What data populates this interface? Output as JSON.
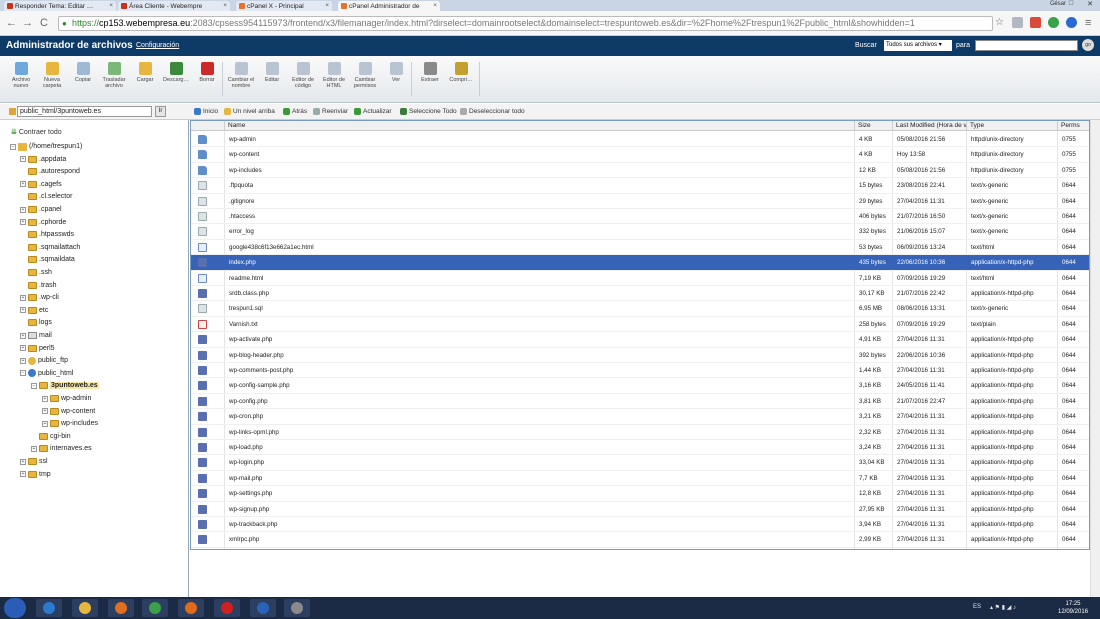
{
  "browser": {
    "tabs": [
      {
        "title": "Responder Tema: Editar …",
        "active": false,
        "favicon_color": "#c8331a"
      },
      {
        "title": "Área Cliente - Webempre",
        "active": false,
        "favicon_color": "#c8331a"
      },
      {
        "title": "cPanel X - Principal",
        "active": false,
        "favicon_color": "#e8722a"
      },
      {
        "title": "cPanel Administrador de",
        "active": true,
        "favicon_color": "#e8722a"
      }
    ],
    "tab_close": "×",
    "profile_name": "César",
    "url": {
      "scheme": "https://",
      "host": "cp153.webempresa.eu",
      "path": ":2083/cpsess954115973/frontend/x3/filemanager/index.html?dirselect=domainrootselect&domainselect=trespuntoweb.es&dir=%2Fhome%2Ftrespun1%2Fpublic_html&showhidden=1"
    },
    "nav": {
      "back": "←",
      "forward": "→",
      "reload": "C"
    }
  },
  "header": {
    "title": "Administrador de archivos",
    "config_link": "Configuración",
    "search_label": "Buscar",
    "search_scope": "Todos sus archivos ▾",
    "search_for": "para",
    "search_value": "",
    "go_label": "go"
  },
  "toolbar": [
    {
      "label": "Archivo nuevo",
      "icon": "new-file-icon",
      "color": "#6fa8dc"
    },
    {
      "label": "Nueva carpeta",
      "icon": "new-folder-icon",
      "color": "#e6b63e"
    },
    {
      "label": "Copiar",
      "icon": "copy-icon",
      "color": "#9fb8d6"
    },
    {
      "label": "Trasladar archivo",
      "icon": "move-icon",
      "color": "#7ab87a"
    },
    {
      "label": "Cargar",
      "icon": "upload-icon",
      "color": "#e6b63e"
    },
    {
      "label": "Descarg…",
      "icon": "download-icon",
      "color": "#3b8a3b"
    },
    {
      "label": "Borrar",
      "icon": "delete-icon",
      "color": "#cc2a2a"
    },
    {
      "label": "Cambiar el nombre",
      "icon": "rename-icon",
      "color": "#b9c4d2"
    },
    {
      "label": "Editar",
      "icon": "edit-icon",
      "color": "#b9c4d2"
    },
    {
      "label": "Editor de código",
      "icon": "code-editor-icon",
      "color": "#b9c4d2"
    },
    {
      "label": "Editor de HTML",
      "icon": "html-editor-icon",
      "color": "#b9c4d2"
    },
    {
      "label": "Cambiar permisos",
      "icon": "permissions-icon",
      "color": "#b9c4d2"
    },
    {
      "label": "Ver",
      "icon": "view-icon",
      "color": "#b9c4d2"
    },
    {
      "label": "Extraer",
      "icon": "extract-icon",
      "color": "#8a8a8a"
    },
    {
      "label": "Compri…",
      "icon": "compress-icon",
      "color": "#c4a030"
    }
  ],
  "path_input": "public_html/3puntoweb.es",
  "path_go": "Ir",
  "tree": {
    "collapse_all": "Contraer todo",
    "nodes": [
      {
        "label": "(/home/trespun1)",
        "depth": 0,
        "expander": "minus",
        "icon": "home"
      },
      {
        "label": ".appdata",
        "depth": 1,
        "expander": "plus",
        "icon": "folder"
      },
      {
        "label": ".autorespond",
        "depth": 1,
        "expander": "none",
        "icon": "folder"
      },
      {
        "label": ".cagefs",
        "depth": 1,
        "expander": "plus",
        "icon": "folder"
      },
      {
        "label": ".cl.selector",
        "depth": 1,
        "expander": "none",
        "icon": "folder"
      },
      {
        "label": ".cpanel",
        "depth": 1,
        "expander": "plus",
        "icon": "folder"
      },
      {
        "label": ".cphorde",
        "depth": 1,
        "expander": "plus",
        "icon": "folder"
      },
      {
        "label": ".htpasswds",
        "depth": 1,
        "expander": "none",
        "icon": "folder"
      },
      {
        "label": ".sqmailattach",
        "depth": 1,
        "expander": "none",
        "icon": "folder"
      },
      {
        "label": ".sqmaildata",
        "depth": 1,
        "expander": "none",
        "icon": "folder"
      },
      {
        "label": ".ssh",
        "depth": 1,
        "expander": "none",
        "icon": "folder"
      },
      {
        "label": ".trash",
        "depth": 1,
        "expander": "none",
        "icon": "folder"
      },
      {
        "label": ".wp-cli",
        "depth": 1,
        "expander": "plus",
        "icon": "folder"
      },
      {
        "label": "etc",
        "depth": 1,
        "expander": "plus",
        "icon": "folder"
      },
      {
        "label": "logs",
        "depth": 1,
        "expander": "none",
        "icon": "folder"
      },
      {
        "label": "mail",
        "depth": 1,
        "expander": "plus",
        "icon": "mail"
      },
      {
        "label": "perl5",
        "depth": 1,
        "expander": "plus",
        "icon": "folder"
      },
      {
        "label": "public_ftp",
        "depth": 1,
        "expander": "plus",
        "icon": "ftp"
      },
      {
        "label": "public_html",
        "depth": 1,
        "expander": "minus",
        "icon": "globe"
      },
      {
        "label": "3puntoweb.es",
        "depth": 2,
        "expander": "minus",
        "icon": "folder",
        "selected": true
      },
      {
        "label": "wp-admin",
        "depth": 3,
        "expander": "plus",
        "icon": "folder"
      },
      {
        "label": "wp-content",
        "depth": 3,
        "expander": "plus",
        "icon": "folder"
      },
      {
        "label": "wp-includes",
        "depth": 3,
        "expander": "plus",
        "icon": "folder"
      },
      {
        "label": "cgi-bin",
        "depth": 2,
        "expander": "none",
        "icon": "folder"
      },
      {
        "label": "internaves.es",
        "depth": 2,
        "expander": "plus",
        "icon": "folder"
      },
      {
        "label": "ssl",
        "depth": 1,
        "expander": "plus",
        "icon": "folder"
      },
      {
        "label": "tmp",
        "depth": 1,
        "expander": "plus",
        "icon": "folder"
      }
    ]
  },
  "actions": [
    {
      "label": "Inicio",
      "icon": "home-icon",
      "color": "#3a7ac8"
    },
    {
      "label": "Un nivel arriba",
      "icon": "up-level-icon",
      "color": "#e6b63e"
    },
    {
      "label": "Atrás",
      "icon": "back-arrow-icon",
      "color": "#3a9a3a"
    },
    {
      "label": "Reenviar",
      "icon": "forward-arrow-icon",
      "color": "#9aa"
    },
    {
      "label": "Actualizar",
      "icon": "refresh-icon",
      "color": "#3a9a3a"
    },
    {
      "label": "Seleccione Todo",
      "icon": "select-all-icon",
      "color": "#3a7a3a"
    },
    {
      "label": "Deseleccionar todo",
      "icon": "deselect-all-icon",
      "color": "#aaa"
    }
  ],
  "file_table": {
    "columns": [
      "Name",
      "Size",
      "Last Modified (Hora de v",
      "Type",
      "Perms"
    ],
    "rows": [
      {
        "name": "wp-admin",
        "size": "4 KB",
        "modified": "05/08/2016 21:56",
        "type": "httpd/unix-directory",
        "perms": "0755",
        "kind": "dir"
      },
      {
        "name": "wp-content",
        "size": "4 KB",
        "modified": "Hoy 13:58",
        "type": "httpd/unix-directory",
        "perms": "0755",
        "kind": "dir"
      },
      {
        "name": "wp-includes",
        "size": "12 KB",
        "modified": "05/08/2016 21:56",
        "type": "httpd/unix-directory",
        "perms": "0755",
        "kind": "dir"
      },
      {
        "name": ".ftpquota",
        "size": "15 bytes",
        "modified": "23/08/2016 22:41",
        "type": "text/x-generic",
        "perms": "0644",
        "kind": "txt"
      },
      {
        "name": ".gitignore",
        "size": "29 bytes",
        "modified": "27/04/2016 11:31",
        "type": "text/x-generic",
        "perms": "0644",
        "kind": "txt"
      },
      {
        "name": ".htaccess",
        "size": "406 bytes",
        "modified": "21/07/2016 16:50",
        "type": "text/x-generic",
        "perms": "0644",
        "kind": "txt"
      },
      {
        "name": "error_log",
        "size": "332 bytes",
        "modified": "21/06/2016 15:07",
        "type": "text/x-generic",
        "perms": "0644",
        "kind": "txt"
      },
      {
        "name": "google438c6f13e662a1ec.html",
        "size": "53 bytes",
        "modified": "06/09/2016 13:24",
        "type": "text/html",
        "perms": "0644",
        "kind": "html"
      },
      {
        "name": "index.php",
        "size": "435 bytes",
        "modified": "22/06/2016 10:36",
        "type": "application/x-httpd-php",
        "perms": "0644",
        "kind": "php",
        "selected": true
      },
      {
        "name": "readme.html",
        "size": "7,19 KB",
        "modified": "07/09/2016 19:29",
        "type": "text/html",
        "perms": "0644",
        "kind": "html"
      },
      {
        "name": "srdb.class.php",
        "size": "30,17 KB",
        "modified": "21/07/2016 22:42",
        "type": "application/x-httpd-php",
        "perms": "0644",
        "kind": "php"
      },
      {
        "name": "trespun1.sql",
        "size": "6,95 MB",
        "modified": "08/06/2016 13:31",
        "type": "text/x-generic",
        "perms": "0644",
        "kind": "txt"
      },
      {
        "name": "Varnish.txt",
        "size": "258 bytes",
        "modified": "07/09/2016 19:29",
        "type": "text/plain",
        "perms": "0644",
        "kind": "plain"
      },
      {
        "name": "wp-activate.php",
        "size": "4,91 KB",
        "modified": "27/04/2016 11:31",
        "type": "application/x-httpd-php",
        "perms": "0644",
        "kind": "php"
      },
      {
        "name": "wp-blog-header.php",
        "size": "392 bytes",
        "modified": "22/06/2016 10:36",
        "type": "application/x-httpd-php",
        "perms": "0644",
        "kind": "php"
      },
      {
        "name": "wp-comments-post.php",
        "size": "1,44 KB",
        "modified": "27/04/2016 11:31",
        "type": "application/x-httpd-php",
        "perms": "0644",
        "kind": "php"
      },
      {
        "name": "wp-config-sample.php",
        "size": "3,16 KB",
        "modified": "24/05/2016 11:41",
        "type": "application/x-httpd-php",
        "perms": "0644",
        "kind": "php"
      },
      {
        "name": "wp-config.php",
        "size": "3,81 KB",
        "modified": "21/07/2016 22:47",
        "type": "application/x-httpd-php",
        "perms": "0644",
        "kind": "php"
      },
      {
        "name": "wp-cron.php",
        "size": "3,21 KB",
        "modified": "27/04/2016 11:31",
        "type": "application/x-httpd-php",
        "perms": "0644",
        "kind": "php"
      },
      {
        "name": "wp-links-opml.php",
        "size": "2,32 KB",
        "modified": "27/04/2016 11:31",
        "type": "application/x-httpd-php",
        "perms": "0644",
        "kind": "php"
      },
      {
        "name": "wp-load.php",
        "size": "3,24 KB",
        "modified": "27/04/2016 11:31",
        "type": "application/x-httpd-php",
        "perms": "0644",
        "kind": "php"
      },
      {
        "name": "wp-login.php",
        "size": "33,04 KB",
        "modified": "27/04/2016 11:31",
        "type": "application/x-httpd-php",
        "perms": "0644",
        "kind": "php"
      },
      {
        "name": "wp-mail.php",
        "size": "7,7 KB",
        "modified": "27/04/2016 11:31",
        "type": "application/x-httpd-php",
        "perms": "0644",
        "kind": "php"
      },
      {
        "name": "wp-settings.php",
        "size": "12,8 KB",
        "modified": "27/04/2016 11:31",
        "type": "application/x-httpd-php",
        "perms": "0644",
        "kind": "php"
      },
      {
        "name": "wp-signup.php",
        "size": "27,95 KB",
        "modified": "27/04/2016 11:31",
        "type": "application/x-httpd-php",
        "perms": "0644",
        "kind": "php"
      },
      {
        "name": "wp-trackback.php",
        "size": "3,94 KB",
        "modified": "27/04/2016 11:31",
        "type": "application/x-httpd-php",
        "perms": "0644",
        "kind": "php"
      },
      {
        "name": "xmlrpc.php",
        "size": "2,99 KB",
        "modified": "27/04/2016 11:31",
        "type": "application/x-httpd-php",
        "perms": "0644",
        "kind": "php"
      }
    ]
  },
  "taskbar": {
    "apps": [
      {
        "icon": "ie-icon",
        "color": "#2a7ad0"
      },
      {
        "icon": "file-explorer-icon",
        "color": "#e6b63e"
      },
      {
        "icon": "media-player-icon",
        "color": "#e07020"
      },
      {
        "icon": "chrome-icon",
        "color": "#3aa04a"
      },
      {
        "icon": "firefox-icon",
        "color": "#e06a1a"
      },
      {
        "icon": "opera-icon",
        "color": "#d02020"
      },
      {
        "icon": "outlook-icon",
        "color": "#2a62b8"
      },
      {
        "icon": "snipping-tool-icon",
        "color": "#8a8a8a"
      }
    ],
    "lang": "ES",
    "time": "17:25",
    "date": "12/09/2016"
  }
}
